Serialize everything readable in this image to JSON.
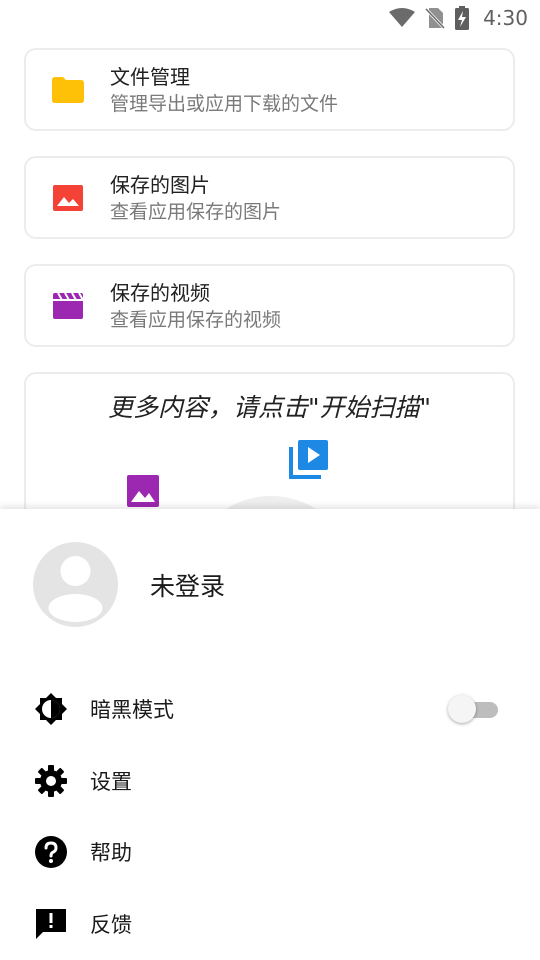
{
  "status_bar": {
    "time": "4:30",
    "icons": [
      "wifi-icon",
      "no-sim-icon",
      "battery-charging-icon"
    ]
  },
  "cards": [
    {
      "title": "文件管理",
      "subtitle": "管理导出或应用下载的文件",
      "icon": "folder-icon",
      "color": "#FFC107"
    },
    {
      "title": "保存的图片",
      "subtitle": "查看应用保存的图片",
      "icon": "image-icon",
      "color": "#F44336"
    },
    {
      "title": "保存的视频",
      "subtitle": "查看应用保存的视频",
      "icon": "movie-icon",
      "color": "#9C27B0"
    }
  ],
  "scan": {
    "prompt": "更多内容，请点击\"开始扫描\"",
    "icons": [
      "video-library-icon",
      "image-icon"
    ],
    "colors": {
      "video": "#1E88E5",
      "image": "#9C27B0"
    }
  },
  "drawer": {
    "user_name": "未登录",
    "menu": [
      {
        "label": "暗黑模式",
        "icon": "brightness-icon"
      },
      {
        "label": "设置",
        "icon": "gear-icon"
      },
      {
        "label": "帮助",
        "icon": "help-icon"
      },
      {
        "label": "反馈",
        "icon": "feedback-icon"
      }
    ],
    "dark_mode_enabled": false
  }
}
